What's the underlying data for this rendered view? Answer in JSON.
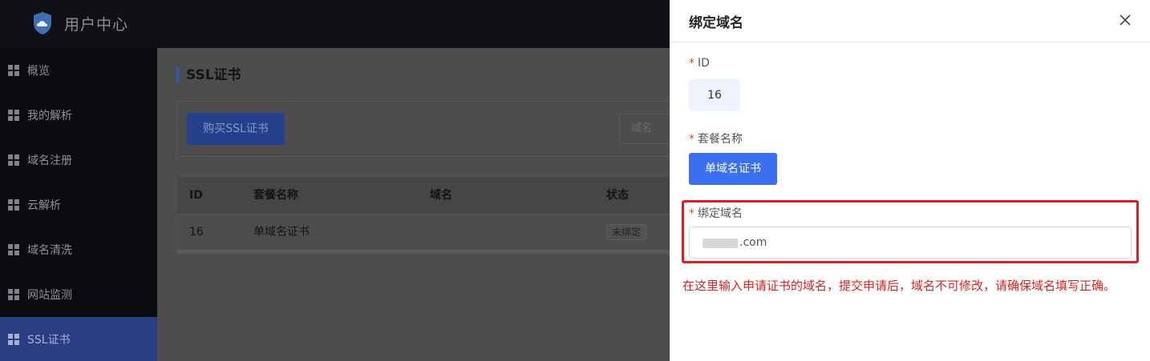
{
  "header": {
    "app_title": "用户中心",
    "logo_icon": "cloud-shield-icon"
  },
  "sidebar": {
    "items": [
      {
        "label": "概览",
        "icon": "grid-icon",
        "active": false
      },
      {
        "label": "我的解析",
        "icon": "grid-icon",
        "active": false
      },
      {
        "label": "域名注册",
        "icon": "grid-icon",
        "active": false
      },
      {
        "label": "云解析",
        "icon": "grid-icon",
        "active": false
      },
      {
        "label": "域名清洗",
        "icon": "grid-icon",
        "active": false
      },
      {
        "label": "网站监测",
        "icon": "grid-icon",
        "active": false
      },
      {
        "label": "SSL证书",
        "icon": "grid-icon",
        "active": true
      }
    ]
  },
  "main": {
    "page_title": "SSL证书",
    "buy_button": "购买SSL证书",
    "search_placeholder": "域名",
    "table": {
      "columns": [
        "ID",
        "套餐名称",
        "域名",
        "状态"
      ],
      "rows": [
        {
          "id": "16",
          "plan": "单域名证书",
          "domain": "",
          "status": "未绑定"
        }
      ]
    }
  },
  "drawer": {
    "title": "绑定域名",
    "required_mark": "*",
    "id_label": "ID",
    "id_value": "16",
    "plan_label": "套餐名称",
    "plan_value": "单域名证书",
    "domain_label": "绑定域名",
    "domain_value_suffix": ".com",
    "note": "在这里输入申请证书的域名，提交申请后，域名不可修改，请确保域名填写正确。"
  },
  "colors": {
    "accent": "#3a6ff0",
    "annotation": "#e02020",
    "sidebar_active": "#2a3d82"
  }
}
